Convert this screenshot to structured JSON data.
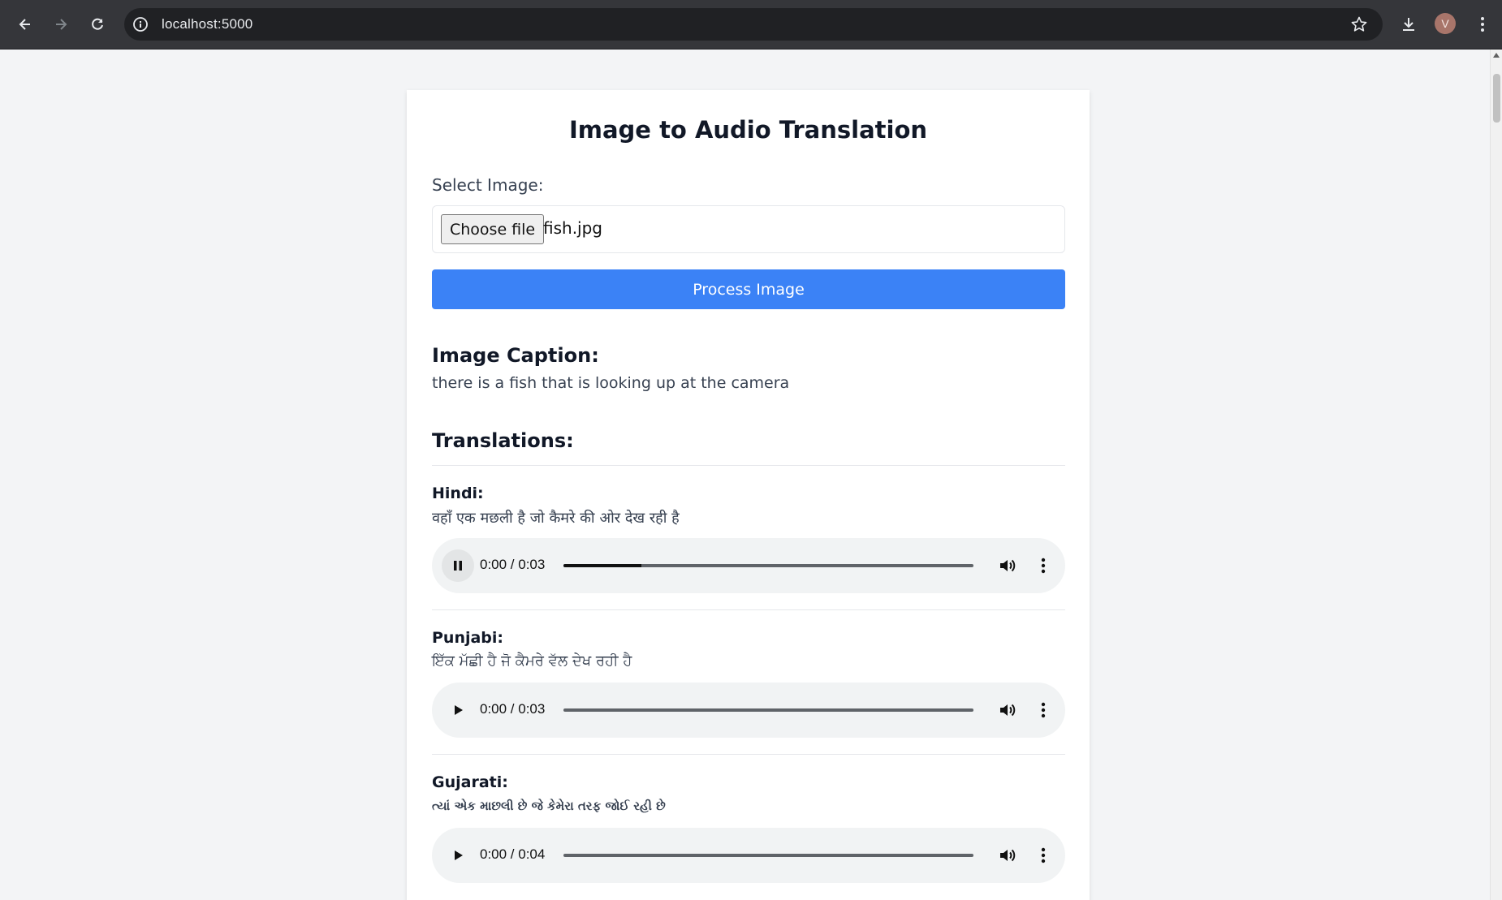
{
  "browser": {
    "url": "localhost:5000",
    "profile_initial": "V"
  },
  "page": {
    "title": "Image to Audio Translation",
    "select_label": "Select Image:",
    "choose_file_label": "Choose file",
    "file_name": "fish.jpg",
    "process_button": "Process Image",
    "caption_heading": "Image Caption:",
    "caption_text": "there is a fish that is looking up at the camera",
    "translations_heading": "Translations:"
  },
  "translations": [
    {
      "language": "Hindi:",
      "text": "वहाँ एक मछली है जो कैमरे की ओर देख रही है",
      "time": "0:00 / 0:03",
      "state": "playing",
      "progress": 0.19
    },
    {
      "language": "Punjabi:",
      "text": "ਇੱਕ ਮੱਛੀ ਹੈ ਜੋ ਕੈਮਰੇ ਵੱਲ ਦੇਖ ਰਹੀ ਹੈ",
      "time": "0:00 / 0:03",
      "state": "paused",
      "progress": 0
    },
    {
      "language": "Gujarati:",
      "text": "ત્યાં એક માછલી છે જે કેમેરા તરફ જોઈ રહી છે",
      "time": "0:00 / 0:04",
      "state": "paused",
      "progress": 0
    }
  ],
  "colors": {
    "accent": "#3b82f6",
    "chrome": "#35363a",
    "page_bg": "#f3f4f6"
  },
  "icons": [
    "back-icon",
    "forward-icon",
    "reload-icon",
    "info-icon",
    "star-icon",
    "download-icon",
    "kebab-menu-icon",
    "pause-icon",
    "play-icon",
    "volume-icon",
    "more-options-icon"
  ]
}
